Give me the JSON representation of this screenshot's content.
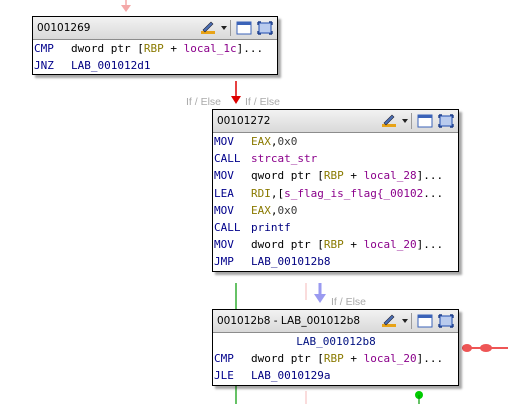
{
  "edge_labels": [
    "If / Else",
    "If / Else",
    "If / Else"
  ],
  "blocks": [
    {
      "title": "00101269",
      "lines": [
        {
          "mnemonic": "CMP",
          "ops": [
            {
              "t": "dword ptr [",
              "c": ""
            },
            {
              "t": "RBP",
              "c": "reg"
            },
            {
              "t": " + ",
              "c": ""
            },
            {
              "t": "local_1c",
              "c": "var"
            },
            {
              "t": "]...",
              "c": ""
            }
          ]
        },
        {
          "mnemonic": "JNZ",
          "ops": [
            {
              "t": "LAB_001012d1",
              "c": "sym"
            }
          ]
        }
      ]
    },
    {
      "title": "00101272",
      "lines": [
        {
          "mnemonic": "MOV",
          "ops": [
            {
              "t": "EAX",
              "c": "reg"
            },
            {
              "t": ",",
              "c": ""
            },
            {
              "t": "0x0",
              "c": "num"
            }
          ]
        },
        {
          "mnemonic": "CALL",
          "ops": [
            {
              "t": "strcat_str",
              "c": "var"
            }
          ]
        },
        {
          "mnemonic": "MOV",
          "ops": [
            {
              "t": "qword ptr [",
              "c": ""
            },
            {
              "t": "RBP",
              "c": "reg"
            },
            {
              "t": " + ",
              "c": ""
            },
            {
              "t": "local_28",
              "c": "var"
            },
            {
              "t": "]...",
              "c": ""
            }
          ]
        },
        {
          "mnemonic": "LEA",
          "ops": [
            {
              "t": "RDI",
              "c": "reg"
            },
            {
              "t": ",[",
              "c": ""
            },
            {
              "t": "s_flag_is_flag{_00102",
              "c": "var"
            },
            {
              "t": "...",
              "c": ""
            }
          ]
        },
        {
          "mnemonic": "MOV",
          "ops": [
            {
              "t": "EAX",
              "c": "reg"
            },
            {
              "t": ",",
              "c": ""
            },
            {
              "t": "0x0",
              "c": "num"
            }
          ]
        },
        {
          "mnemonic": "CALL",
          "ops": [
            {
              "t": "printf",
              "c": "sym"
            }
          ]
        },
        {
          "mnemonic": "MOV",
          "ops": [
            {
              "t": "dword ptr [",
              "c": ""
            },
            {
              "t": "RBP",
              "c": "reg"
            },
            {
              "t": " + ",
              "c": ""
            },
            {
              "t": "local_20",
              "c": "var"
            },
            {
              "t": "]...",
              "c": ""
            }
          ]
        },
        {
          "mnemonic": "JMP",
          "ops": [
            {
              "t": "LAB_001012b8",
              "c": "sym"
            }
          ]
        }
      ]
    },
    {
      "title": "001012b8 - LAB_001012b8",
      "label_line": "LAB_001012b8",
      "lines": [
        {
          "mnemonic": "CMP",
          "ops": [
            {
              "t": "dword ptr [",
              "c": ""
            },
            {
              "t": "RBP",
              "c": "reg"
            },
            {
              "t": " + ",
              "c": ""
            },
            {
              "t": "local_20",
              "c": "var"
            },
            {
              "t": "]...",
              "c": ""
            }
          ]
        },
        {
          "mnemonic": "JLE",
          "ops": [
            {
              "t": "LAB_0010129a",
              "c": "sym"
            }
          ]
        }
      ]
    }
  ],
  "toolbar_icons": [
    "edit-fill-color-icon",
    "dropdown-arrow-icon",
    "restore-window-icon",
    "maximize-block-icon"
  ],
  "colors": {
    "edge_conditional_true": "#dd0000",
    "edge_unconditional": "#8888ee",
    "edge_false": "#f2aaaa",
    "edge_fallthrough": "#009900",
    "header_gradient_top": "#f2f2f2",
    "header_gradient_bottom": "#d9d9d9"
  }
}
